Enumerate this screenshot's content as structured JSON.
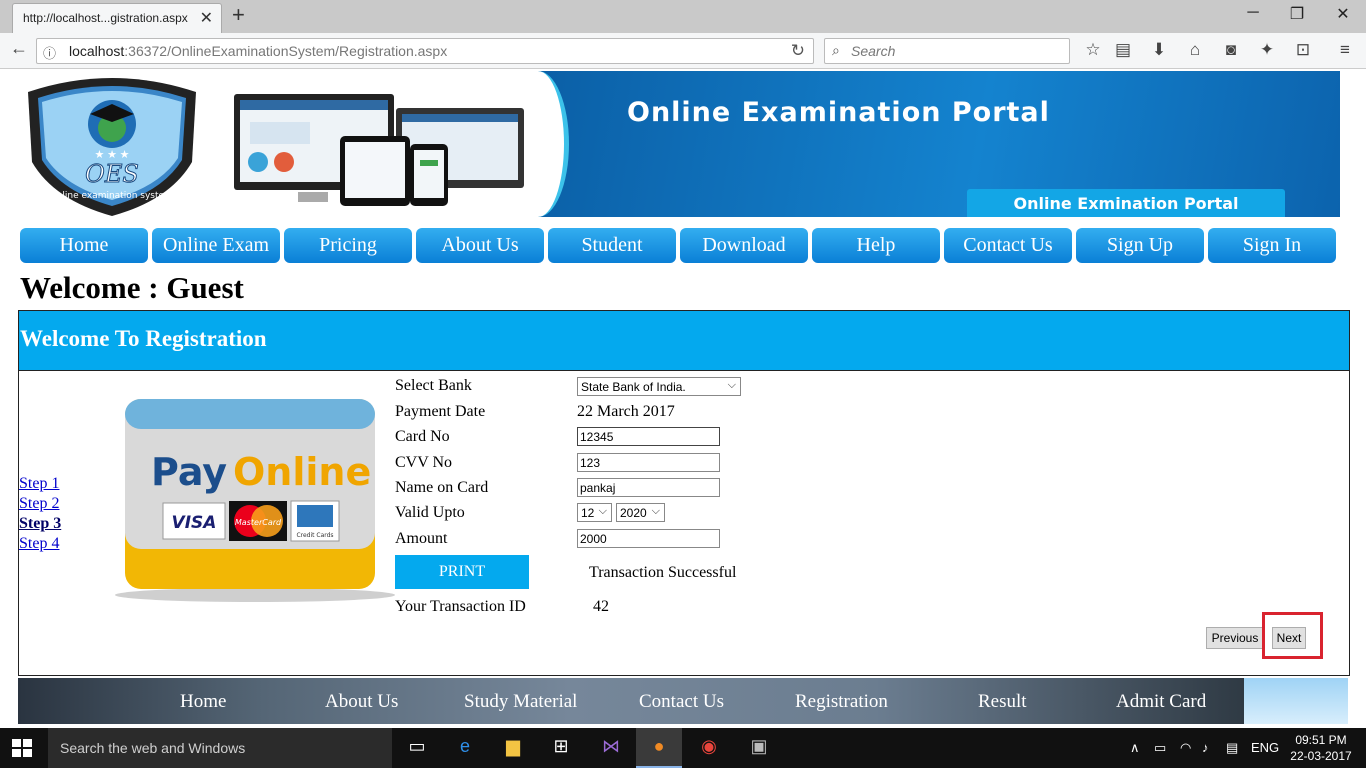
{
  "browser": {
    "tab_title": "http://localhost...gistration.aspx",
    "url_host": "localhost",
    "url_rest": ":36372/OnlineExaminationSystem/Registration.aspx",
    "search_placeholder": "Search"
  },
  "banner": {
    "logo_text": "OES",
    "logo_ring_text": "online examination system",
    "title": "Online Examination Portal",
    "subtitle": "Online Exmination Portal"
  },
  "menu": [
    "Home",
    "Online Exam",
    "Pricing",
    "About Us",
    "Student",
    "Download",
    "Help",
    "Contact Us",
    "Sign Up",
    "Sign In"
  ],
  "welcome": "Welcome : Guest",
  "registration": {
    "heading": "Welcome To Registration",
    "steps": [
      "Step 1",
      "Step 2",
      "Step 3",
      "Step 4"
    ],
    "active_step": "Step 3",
    "image_text": {
      "pay": "Pay",
      "online": "Online",
      "visa": "VISA",
      "mastercard": "MasterCard",
      "credit_cards": "Credit Cards"
    },
    "form": {
      "select_bank_label": "Select Bank",
      "select_bank_value": "State Bank of India.",
      "payment_date_label": "Payment Date",
      "payment_date_value": "22 March 2017",
      "card_no_label": "Card No",
      "card_no_value": "12345",
      "cvv_label": "CVV No",
      "cvv_value": "123",
      "name_label": "Name on Card",
      "name_value": "pankaj",
      "valid_label": "Valid Upto",
      "valid_month": "12",
      "valid_year": "2020",
      "amount_label": "Amount",
      "amount_value": "2000",
      "print_label": "PRINT",
      "status_text": "Transaction Successful",
      "txn_label": "Your Transaction ID",
      "txn_value": "42"
    },
    "previous_label": "Previous",
    "next_label": "Next"
  },
  "footer_nav": [
    "Home",
    "About Us",
    "Study Material",
    "Contact Us",
    "Registration",
    "Result",
    "Admit Card"
  ],
  "taskbar": {
    "search_placeholder": "Search the web and Windows",
    "lang": "ENG",
    "time": "09:51 PM",
    "date": "22-03-2017"
  },
  "colors": {
    "accent": "#04a9ee",
    "menu": "#0a7fd6",
    "highlight": "#d9232f"
  }
}
